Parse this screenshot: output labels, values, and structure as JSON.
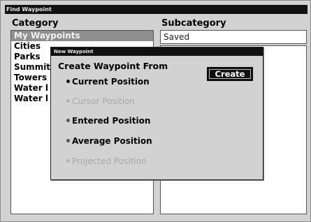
{
  "window": {
    "title": "Find Waypoint"
  },
  "category": {
    "header": "Category",
    "items": [
      {
        "label": "My Waypoints",
        "selected": true
      },
      {
        "label": "Cities"
      },
      {
        "label": "Parks"
      },
      {
        "label": "Summit"
      },
      {
        "label": "Towers"
      },
      {
        "label": "Water l"
      },
      {
        "label": "Water l"
      }
    ]
  },
  "subcategory": {
    "header": "Subcategory",
    "value": "Saved"
  },
  "dialog": {
    "title": "New Waypoint",
    "heading": "Create Waypoint From",
    "create_label": "Create",
    "options": [
      {
        "label": "Current Position",
        "state": "selected"
      },
      {
        "label": "Cursor Position",
        "state": "disabled"
      },
      {
        "label": "Entered Position",
        "state": "enabled"
      },
      {
        "label": "Average Position",
        "state": "enabled"
      },
      {
        "label": "Projected Position",
        "state": "disabled"
      }
    ]
  }
}
